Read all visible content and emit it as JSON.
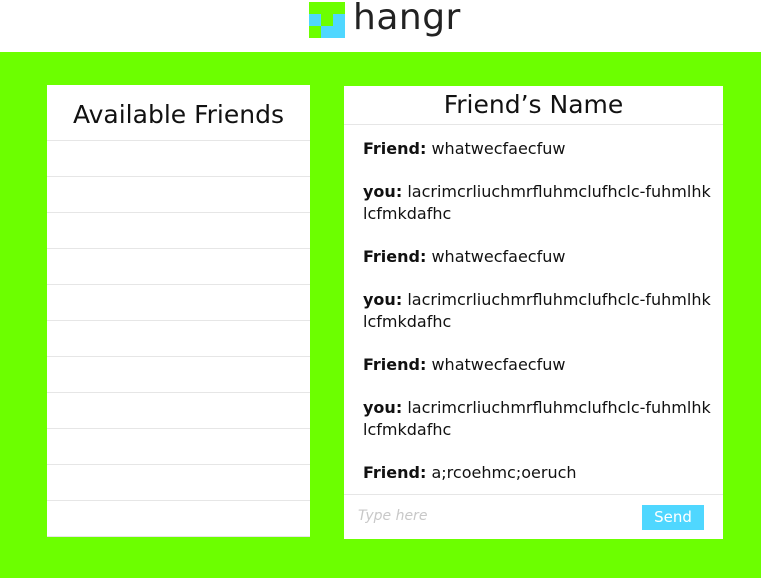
{
  "brand": {
    "name": "hangr",
    "logo_colors": [
      "#6cff00",
      "#4fd7ff",
      "#6cff00",
      "#4fd7ff"
    ]
  },
  "friends_panel": {
    "title": "Available Friends",
    "row_count": 11
  },
  "chat": {
    "title": "Friend’s Name",
    "messages": [
      {
        "sender": "Friend:",
        "text": "whatwecfaecfuw"
      },
      {
        "sender": "you:",
        "text": "lacrimcrliuchmrfluhmclufhclc-fuhmlhklcfmkdafhc"
      },
      {
        "sender": "Friend:",
        "text": "whatwecfaecfuw"
      },
      {
        "sender": "you:",
        "text": "lacrimcrliuchmrfluhmclufhclc-fuhmlhklcfmkdafhc"
      },
      {
        "sender": "Friend:",
        "text": "whatwecfaecfuw"
      },
      {
        "sender": "you:",
        "text": "lacrimcrliuchmrfluhmclufhclc-fuhmlhklcfmkdafhc"
      },
      {
        "sender": "Friend:",
        "text": "a;rcoehmc;oeruch"
      }
    ],
    "input_placeholder": "Type here",
    "input_value": "",
    "send_label": "Send"
  },
  "colors": {
    "background": "#6cff00",
    "accent": "#4fd7ff"
  }
}
